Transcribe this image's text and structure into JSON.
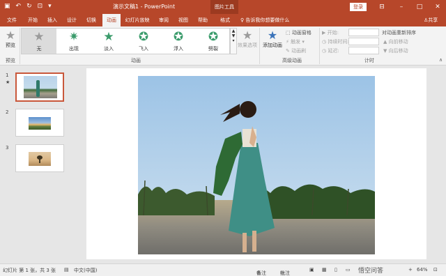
{
  "title_bar": {
    "document_title": "演示文稿1 - PowerPoint",
    "picture_tools_label": "图片工具",
    "login_label": "登录",
    "qat_icons": [
      "save-icon",
      "undo-icon",
      "redo-icon",
      "present-icon",
      "dropdown-icon"
    ]
  },
  "tabs": [
    "文件",
    "开始",
    "插入",
    "设计",
    "切换",
    "动画",
    "幻灯片放映",
    "审阅",
    "视图",
    "帮助",
    "格式"
  ],
  "active_tab": "动画",
  "tell_me": "告诉我你想要做什么",
  "share_label": "共享",
  "ribbon": {
    "preview_label": "预览",
    "preview_group": "预览",
    "animation_group": "动画",
    "gallery": [
      "无",
      "出现",
      "淡入",
      "飞入",
      "浮入",
      "劈裂"
    ],
    "effect_options": "效果选项",
    "add_animation": "添加动画",
    "advanced_group": "高级动画",
    "animation_pane": "动画窗格",
    "trigger": "触发",
    "painter": "动画刷",
    "start_label": "开始:",
    "duration_label": "持续时间:",
    "delay_label": "延迟:",
    "timing_group": "计时",
    "reorder_label": "对动画重新排序",
    "move_earlier": "向前移动",
    "move_later": "向后移动"
  },
  "thumbnails": [
    {
      "number": "1",
      "star": "★"
    },
    {
      "number": "2",
      "star": ""
    },
    {
      "number": "3",
      "star": ""
    }
  ],
  "statusbar": {
    "slide_info": "幻灯片 第 1 张，共 3 张",
    "language": "中文(中国)",
    "notes": "备注",
    "comments": "批注",
    "zoom": "64%",
    "watermark": "悟空问答"
  },
  "colors": {
    "accent": "#b7472a",
    "gallery_icon": "#3a9b6b"
  }
}
